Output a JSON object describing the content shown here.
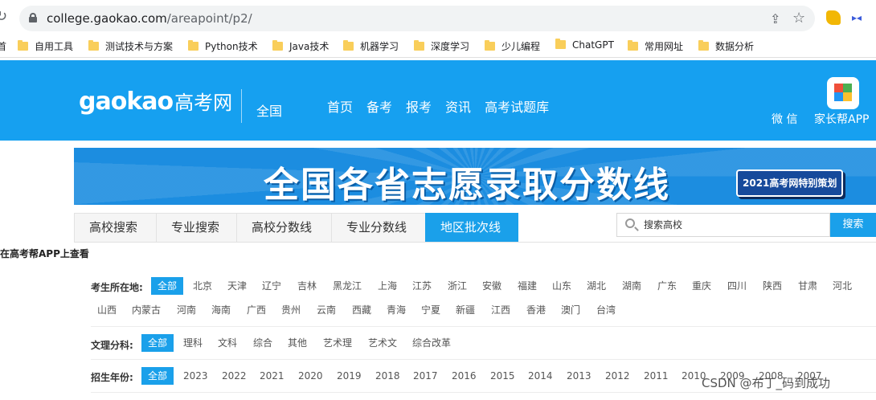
{
  "browser": {
    "url_host": "college.gaokao.com",
    "url_path": "/areapoint/p2/",
    "bookmarks": [
      "自用工具",
      "测试技术与方案",
      "Python技术",
      "Java技术",
      "机器学习",
      "深度学习",
      "少儿编程",
      "ChatGPT",
      "常用网址",
      "数据分析"
    ],
    "bookmarks_left_fragment": "首"
  },
  "header": {
    "logo_en": "gaokao",
    "logo_cn": "高考网",
    "region": "全国",
    "nav": [
      "首页",
      "备考",
      "报考",
      "资讯",
      "高考试题库"
    ],
    "weixin": "微 信",
    "app_label": "家长帮APP"
  },
  "banner": {
    "title": "全国各省志愿录取分数线",
    "badge": "2021高考网特别策划"
  },
  "tabs": [
    "高校搜索",
    "专业搜索",
    "高校分数线",
    "专业分数线",
    "地区批次线"
  ],
  "active_tab": "地区批次线",
  "search": {
    "placeholder": "搜索高校",
    "button": "搜索"
  },
  "app_notice": "在高考帮APP上查看",
  "filters": {
    "region": {
      "label": "考生所在地:",
      "options": [
        "全部",
        "北京",
        "天津",
        "辽宁",
        "吉林",
        "黑龙江",
        "上海",
        "江苏",
        "浙江",
        "安徽",
        "福建",
        "山东",
        "湖北",
        "湖南",
        "广东",
        "重庆",
        "四川",
        "陕西",
        "甘肃",
        "河北",
        "山西",
        "内蒙古",
        "河南",
        "海南",
        "广西",
        "贵州",
        "云南",
        "西藏",
        "青海",
        "宁夏",
        "新疆",
        "江西",
        "香港",
        "澳门",
        "台湾"
      ],
      "selected": "全部"
    },
    "subject": {
      "label": "文理分科:",
      "options": [
        "全部",
        "理科",
        "文科",
        "综合",
        "其他",
        "艺术理",
        "艺术文",
        "综合改革"
      ],
      "selected": "全部"
    },
    "year": {
      "label": "招生年份:",
      "options": [
        "全部",
        "2023",
        "2022",
        "2021",
        "2020",
        "2019",
        "2018",
        "2017",
        "2016",
        "2015",
        "2014",
        "2013",
        "2012",
        "2011",
        "2010",
        "2009",
        "2008",
        "2007"
      ],
      "selected": "全部"
    }
  },
  "watermark": "CSDN @布丁_码到成功"
}
